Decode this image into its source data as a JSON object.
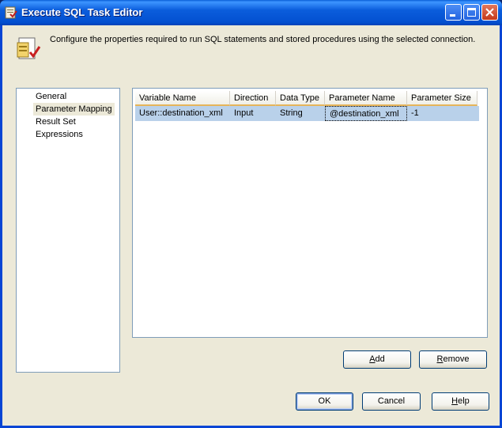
{
  "window": {
    "title": "Execute SQL Task Editor",
    "accent": "#0a5fd8"
  },
  "header": {
    "description": "Configure the properties required to run SQL statements and stored procedures using the selected connection."
  },
  "nav": {
    "items": [
      {
        "label": "General",
        "selected": false
      },
      {
        "label": "Parameter Mapping",
        "selected": true
      },
      {
        "label": "Result Set",
        "selected": false
      },
      {
        "label": "Expressions",
        "selected": false
      }
    ]
  },
  "grid": {
    "columns": [
      "Variable Name",
      "Direction",
      "Data Type",
      "Parameter Name",
      "Parameter Size"
    ],
    "rows": [
      [
        "User::destination_xml",
        "Input",
        "String",
        "@destination_xml",
        "-1"
      ]
    ]
  },
  "buttons": {
    "add_mnemonic": "A",
    "add_rest": "dd",
    "remove_mnemonic": "R",
    "remove_rest": "emove",
    "ok": "OK",
    "cancel": "Cancel",
    "help_mnemonic": "H",
    "help_rest": "elp"
  }
}
